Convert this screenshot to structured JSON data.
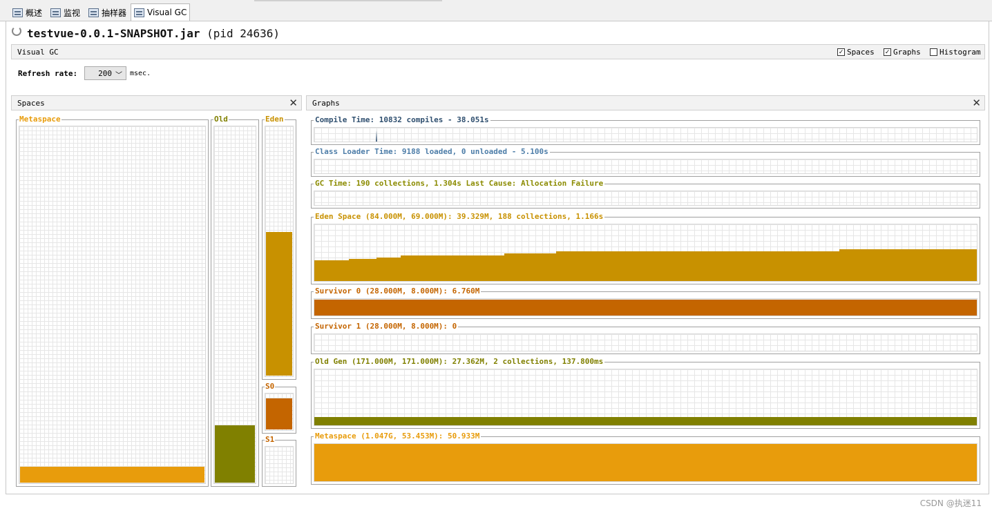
{
  "tabs": [
    {
      "label": "概述",
      "icon": "overview-icon",
      "active": false
    },
    {
      "label": "监视",
      "icon": "monitor-icon",
      "active": false
    },
    {
      "label": "抽样器",
      "icon": "sampler-icon",
      "active": false
    },
    {
      "label": "Visual GC",
      "icon": "visual-gc-icon",
      "active": true
    }
  ],
  "app": {
    "title": "testvue-0.0.1-SNAPSHOT.jar",
    "pid": "(pid 24636)"
  },
  "toolbar": {
    "label": "Visual GC",
    "spaces_label": "Spaces",
    "spaces_checked": true,
    "graphs_label": "Graphs",
    "graphs_checked": true,
    "histogram_label": "Histogram",
    "histogram_checked": false
  },
  "refresh": {
    "label": "Refresh rate:",
    "value": "200",
    "unit": "msec."
  },
  "spaces_panel": {
    "title": "Spaces",
    "close": "✕",
    "metaspace": {
      "label": "Metaspace",
      "fill_fraction": 0.045,
      "color": "#E89C0C"
    },
    "old": {
      "label": "Old",
      "fill_fraction": 0.16,
      "color": "#808000"
    },
    "eden": {
      "label": "Eden",
      "fill_fraction": 0.575,
      "color": "#C89100"
    },
    "s0": {
      "label": "S0",
      "fill_fraction": 0.84,
      "color": "#C46500"
    },
    "s1": {
      "label": "S1",
      "fill_fraction": 0.0,
      "color": "#C46500"
    }
  },
  "graphs_panel": {
    "title": "Graphs",
    "close": "✕",
    "compile_time": {
      "label": "Compile Time: 10832 compiles - 38.051s",
      "color": "#2F4F6F"
    },
    "class_loader": {
      "label": "Class Loader Time: 9188 loaded, 0 unloaded - 5.100s",
      "color": "#4D7DA8"
    },
    "gc_time": {
      "label": "GC Time: 190 collections, 1.304s  Last Cause: Allocation Failure",
      "color": "#8B8B00"
    },
    "eden_space": {
      "label": "Eden Space (84.000M, 69.000M): 39.329M, 188 collections, 1.166s",
      "color": "#C89100"
    },
    "survivor0": {
      "label": "Survivor 0 (28.000M, 8.000M): 6.760M",
      "color": "#C46500"
    },
    "survivor1": {
      "label": "Survivor 1 (28.000M, 8.000M): 0",
      "color": "#C46500"
    },
    "old_gen": {
      "label": "Old Gen (171.000M, 171.000M): 27.362M, 2 collections, 137.800ms",
      "color": "#808000"
    },
    "metaspace": {
      "label": "Metaspace (1.047G, 53.453M): 50.933M",
      "color": "#E89C0C"
    }
  },
  "watermark": "CSDN @执迷11"
}
